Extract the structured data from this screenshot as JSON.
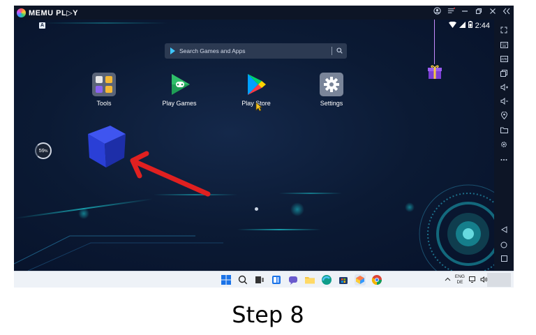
{
  "window": {
    "app_name": "MEMU PL▷Y",
    "controls": [
      "user-icon",
      "menu-icon",
      "minimize-icon",
      "restore-icon",
      "close-icon",
      "collapse-sidebar-icon"
    ]
  },
  "status_bar": {
    "left_badge": "A",
    "time": "2:44",
    "icons": [
      "wifi-icon",
      "signal-icon",
      "battery-icon"
    ]
  },
  "search": {
    "placeholder": "Search Games and Apps"
  },
  "apps": [
    {
      "name": "tools",
      "label": "Tools"
    },
    {
      "name": "play-games",
      "label": "Play Games"
    },
    {
      "name": "play-store",
      "label": "Play Store"
    },
    {
      "name": "settings",
      "label": "Settings"
    }
  ],
  "battery_widget": {
    "value": "59",
    "unit": "%"
  },
  "toolbar": {
    "items": [
      "fullscreen-icon",
      "keyboard-icon",
      "apk-icon",
      "multi-window-icon",
      "volume-up-icon",
      "volume-down-icon",
      "location-icon",
      "folder-icon",
      "settings-gear-icon",
      "more-icon",
      "back-icon",
      "home-icon",
      "recents-icon"
    ]
  },
  "taskbar": {
    "language_line1": "ENG",
    "language_line2": "DE"
  },
  "caption": "Step 8",
  "colors": {
    "accent_cyan": "#1ccfd8",
    "arrow_red": "#e02020",
    "cube_blue": "#2a3fd6",
    "screen_bg": "#0b1a34"
  }
}
